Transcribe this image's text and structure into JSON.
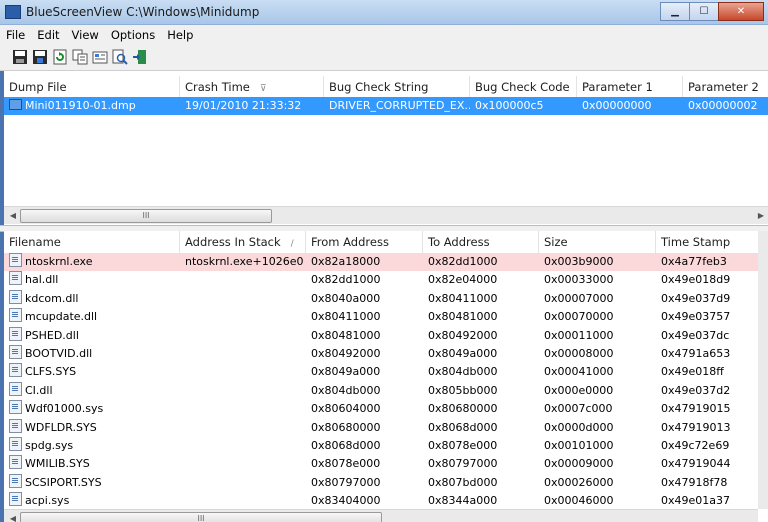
{
  "window": {
    "title": "BlueScreenView    C:\\Windows\\Minidump"
  },
  "menu": [
    "File",
    "Edit",
    "View",
    "Options",
    "Help"
  ],
  "toolbar_icons": [
    "save-icon",
    "save-all-icon",
    "refresh-icon",
    "copy-icon",
    "properties-icon",
    "find-icon",
    "exit-icon"
  ],
  "top_table": {
    "headers": [
      "Dump File",
      "Crash Time",
      "Bug Check String",
      "Bug Check Code",
      "Parameter 1",
      "Parameter 2"
    ],
    "sort_indicator": "⊽",
    "rows": [
      [
        "Mini011910-01.dmp",
        "19/01/2010 21:33:32",
        "DRIVER_CORRUPTED_EX...",
        "0x100000c5",
        "0x00000000",
        "0x00000002"
      ]
    ]
  },
  "bottom_table": {
    "headers": [
      "Filename",
      "Address In Stack",
      "From Address",
      "To Address",
      "Size",
      "Time Stamp"
    ],
    "sort_indicator": "/",
    "rows": [
      [
        "ntoskrnl.exe",
        "ntoskrnl.exe+1026e0",
        "0x82a18000",
        "0x82dd1000",
        "0x003b9000",
        "0x4a77feb3"
      ],
      [
        "hal.dll",
        "",
        "0x82dd1000",
        "0x82e04000",
        "0x00033000",
        "0x49e018d9"
      ],
      [
        "kdcom.dll",
        "",
        "0x8040a000",
        "0x80411000",
        "0x00007000",
        "0x49e037d9"
      ],
      [
        "mcupdate.dll",
        "",
        "0x80411000",
        "0x80481000",
        "0x00070000",
        "0x49e03757"
      ],
      [
        "PSHED.dll",
        "",
        "0x80481000",
        "0x80492000",
        "0x00011000",
        "0x49e037dc"
      ],
      [
        "BOOTVID.dll",
        "",
        "0x80492000",
        "0x8049a000",
        "0x00008000",
        "0x4791a653"
      ],
      [
        "CLFS.SYS",
        "",
        "0x8049a000",
        "0x804db000",
        "0x00041000",
        "0x49e018ff"
      ],
      [
        "CI.dll",
        "",
        "0x804db000",
        "0x805bb000",
        "0x000e0000",
        "0x49e037d2"
      ],
      [
        "Wdf01000.sys",
        "",
        "0x80604000",
        "0x80680000",
        "0x0007c000",
        "0x47919015"
      ],
      [
        "WDFLDR.SYS",
        "",
        "0x80680000",
        "0x8068d000",
        "0x0000d000",
        "0x47919013"
      ],
      [
        "spdg.sys",
        "",
        "0x8068d000",
        "0x8078e000",
        "0x00101000",
        "0x49c72e69"
      ],
      [
        "WMILIB.SYS",
        "",
        "0x8078e000",
        "0x80797000",
        "0x00009000",
        "0x47919044"
      ],
      [
        "SCSIPORT.SYS",
        "",
        "0x80797000",
        "0x807bd000",
        "0x00026000",
        "0x47918f78"
      ],
      [
        "acpi.sys",
        "",
        "0x83404000",
        "0x8344a000",
        "0x00046000",
        "0x49e01a37"
      ]
    ]
  },
  "scroll_grip": "III"
}
